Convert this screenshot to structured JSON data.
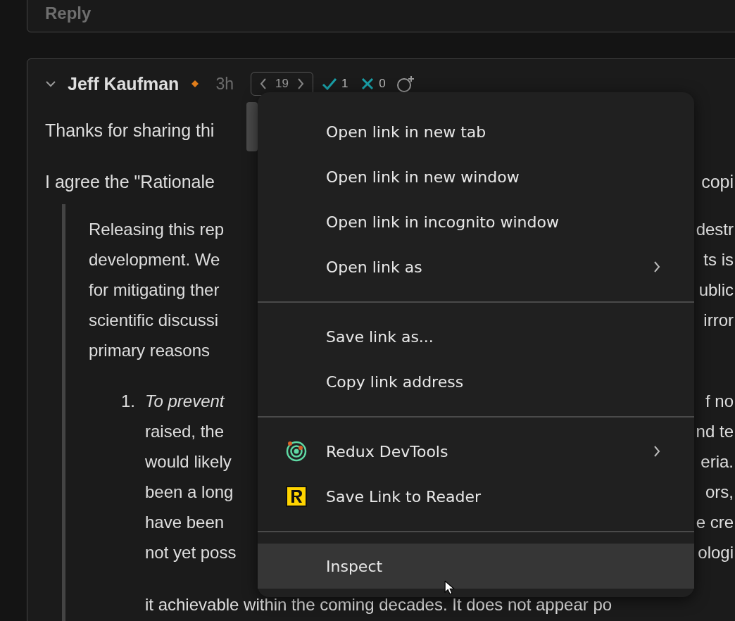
{
  "reply_button": {
    "label": "Reply"
  },
  "comment": {
    "expanded": true,
    "author": "Jeff Kaufman",
    "time": "3h",
    "vote": {
      "score": "19"
    },
    "agree": {
      "count": "1"
    },
    "disagree": {
      "count": "0"
    },
    "intro_lines": [
      {
        "left": "Thanks for sharing thi"
      },
      {
        "left": "I agree the \"Rationale",
        "right": "copi"
      }
    ],
    "quote_lines": [
      {
        "left": "Releasing this rep",
        "right": "destr"
      },
      {
        "left": "development. We",
        "right": "ts is"
      },
      {
        "left": "for mitigating ther",
        "right": "ublic"
      },
      {
        "left": "scientific discussi",
        "right": "irror"
      },
      {
        "left": "primary reasons"
      }
    ],
    "list_lines": [
      {
        "marker": "1.",
        "left": "To prevent",
        "emphasis": true,
        "right": "f no"
      },
      {
        "left": "raised, the",
        "emphasis": false,
        "right": "nd te"
      },
      {
        "left": "would likely",
        "emphasis": false,
        "right": "eria."
      },
      {
        "left": "been a long",
        "emphasis": false,
        "right": "ors,"
      },
      {
        "left": "have been",
        "emphasis": false,
        "right": "e cre"
      },
      {
        "left": "not yet poss",
        "emphasis": false,
        "right": "ologi"
      },
      {
        "left": "it achievable within the coming decades. It does not appear po",
        "emphasis": false
      }
    ]
  },
  "context_menu": {
    "groups": [
      [
        {
          "label": "Open link in new tab",
          "submenu": false,
          "selected": false
        },
        {
          "label": "Open link in new window",
          "submenu": false,
          "selected": false
        },
        {
          "label": "Open link in incognito window",
          "submenu": false,
          "selected": false
        },
        {
          "label": "Open link as",
          "submenu": true,
          "selected": false
        }
      ],
      [
        {
          "label": "Save link as...",
          "submenu": false,
          "selected": false
        },
        {
          "label": "Copy link address",
          "submenu": false,
          "selected": false
        }
      ],
      [
        {
          "label": "Redux DevTools",
          "kind": "extension",
          "submenu": true,
          "selected": false
        },
        {
          "label": "Save Link to Reader",
          "kind": "extension",
          "submenu": false,
          "selected": false
        }
      ],
      [
        {
          "label": "Inspect",
          "submenu": false,
          "selected": true
        }
      ]
    ]
  }
}
